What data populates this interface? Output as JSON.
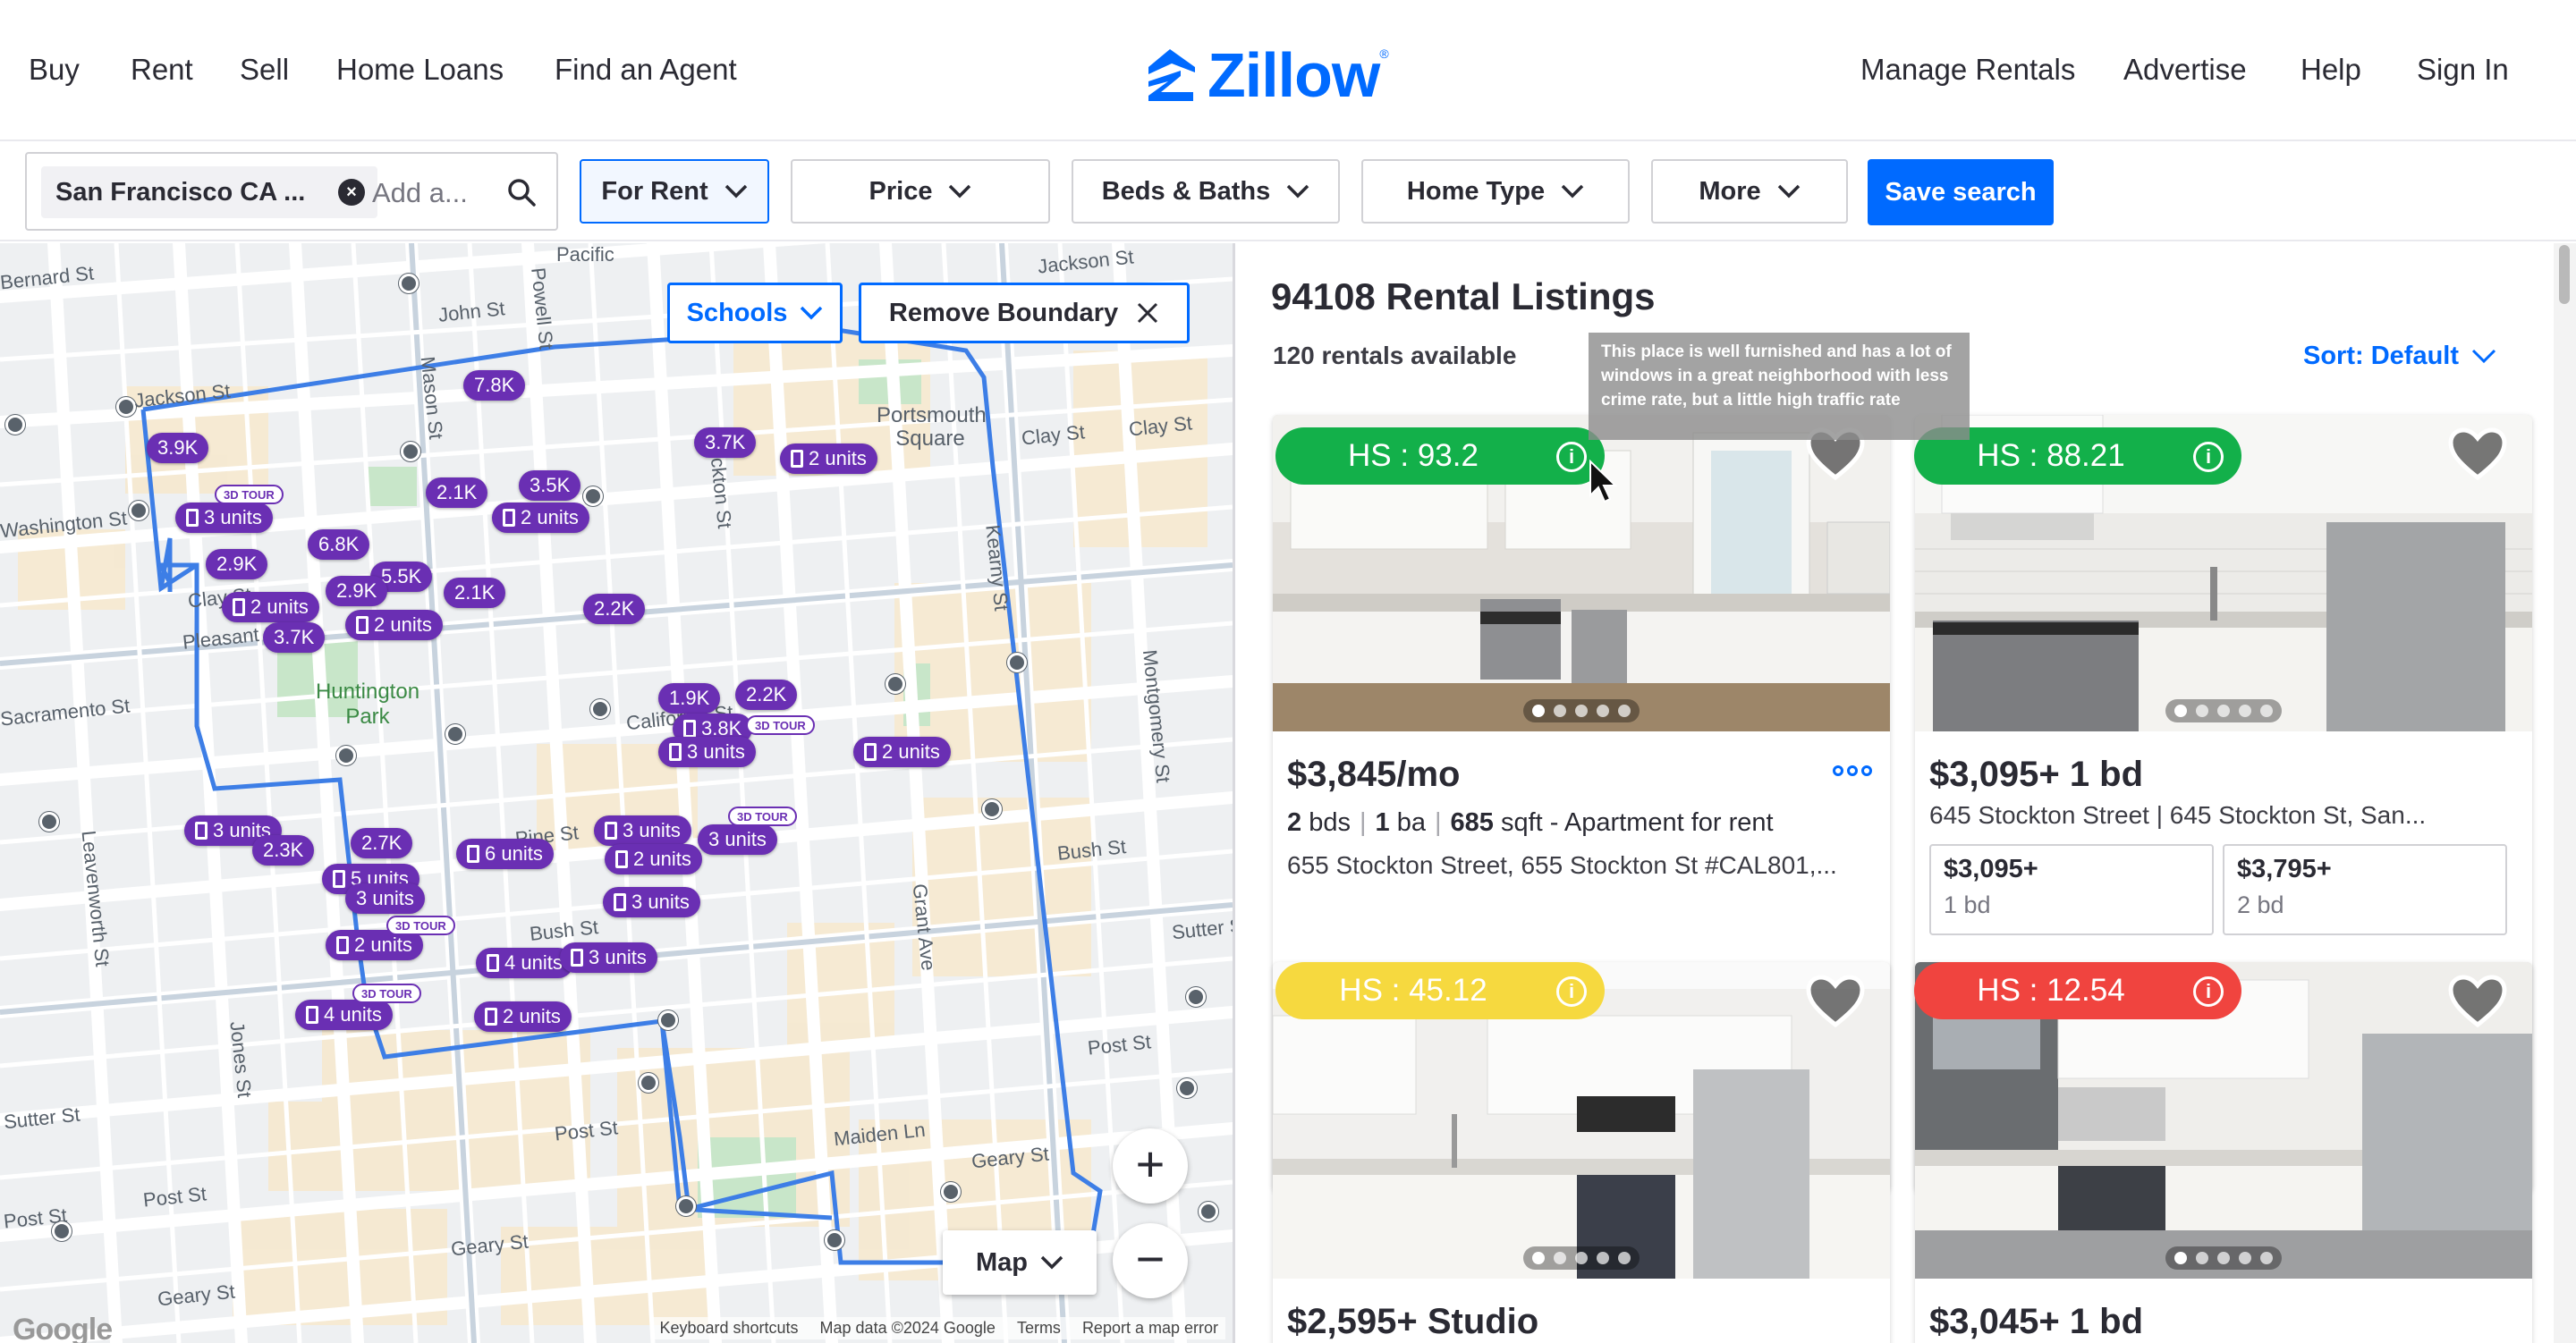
{
  "nav": {
    "left": [
      "Buy",
      "Rent",
      "Sell",
      "Home Loans",
      "Find an Agent"
    ],
    "brand": "Zillow",
    "right": [
      "Manage Rentals",
      "Advertise",
      "Help",
      "Sign In"
    ]
  },
  "filters": {
    "location_chip": "San Francisco CA ...",
    "address_placeholder": "Add a...",
    "for_rent": "For Rent",
    "price": "Price",
    "beds_baths": "Beds & Baths",
    "home_type": "Home Type",
    "more": "More",
    "save_search": "Save search"
  },
  "map": {
    "schools_label": "Schools",
    "remove_boundary_label": "Remove Boundary",
    "map_type_label": "Map",
    "zoom_in": "+",
    "zoom_out": "−",
    "google_logo": "Google",
    "attribution": [
      "Keyboard shortcuts",
      "Map data ©2024 Google",
      "Terms",
      "Report a map error"
    ],
    "streets": [
      "Jackson St",
      "Jackson St",
      "Pacific",
      "John St",
      "Powell St",
      "Mason St",
      "Clay St",
      "Clay St",
      "Portsmouth Square",
      "Stockton St",
      "Kearny St",
      "Montgomery St",
      "Huntington Park",
      "California St",
      "Bush St",
      "Bush St",
      "Pine St",
      "Grant Ave",
      "Post St",
      "Post St",
      "Post St",
      "Post St",
      "Sutter St",
      "Sutter St",
      "Maiden Ln",
      "Geary St",
      "Geary St",
      "Geary St",
      "Jones St",
      "Leavenworth St",
      "Bernard St",
      "Pleasant St",
      "Sacramento St",
      "Washington St",
      "Clay St"
    ],
    "markers": [
      "7.8K",
      "3.9K",
      "3 units",
      "2.9K",
      "6.8K",
      "2.1K",
      "3.5K",
      "2 units",
      "3.7K",
      "2 units",
      "5.5K",
      "2.9K",
      "2 units",
      "3.7K",
      "2 units",
      "2.1K",
      "2.2K",
      "1.9K",
      "2.2K",
      "3.8K",
      "3 units",
      "2 units",
      "3 units",
      "2.3K",
      "2.7K",
      "5 units",
      "3 units",
      "6 units",
      "3 units",
      "2 units",
      "3 units",
      "2 units",
      "3 units",
      "4 units",
      "2 units",
      "4 units",
      "3 units"
    ],
    "tour_badge": "3D TOUR"
  },
  "listings": {
    "title": "94108 Rental Listings",
    "count": "120 rentals available",
    "sort": "Sort: Default",
    "tooltip": "This place is well furnished and has a lot of windows in a great neighborhood with less crime rate, but a little high traffic rate",
    "cards": [
      {
        "hs": "HS : 93.2",
        "hs_color": "#13b04a",
        "price": "$3,845/mo",
        "beds": "2",
        "beds_label": "bds",
        "baths": "1",
        "baths_label": "ba",
        "sqft": "685",
        "sqft_label": "sqft - Apartment for rent",
        "address": "655 Stockton Street, 655 Stockton St #CAL801,..."
      },
      {
        "hs": "HS : 88.21",
        "hs_color": "#13b04a",
        "price": "$3,095+ 1 bd",
        "address": "645 Stockton Street | 645 Stockton St, San...",
        "units": [
          {
            "price": "$3,095+",
            "beds": "1 bd"
          },
          {
            "price": "$3,795+",
            "beds": "2 bd"
          }
        ]
      },
      {
        "hs": "HS : 45.12",
        "hs_color": "#f6d93f",
        "price": "$2,595+ Studio"
      },
      {
        "hs": "HS : 12.54",
        "hs_color": "#f0443f",
        "price": "$3,045+ 1 bd"
      }
    ]
  },
  "colors": {
    "brand": "#006aff",
    "marker": "#6a2fb3",
    "hs_green": "#13b04a",
    "hs_yellow": "#f6d93f",
    "hs_red": "#f0443f"
  }
}
